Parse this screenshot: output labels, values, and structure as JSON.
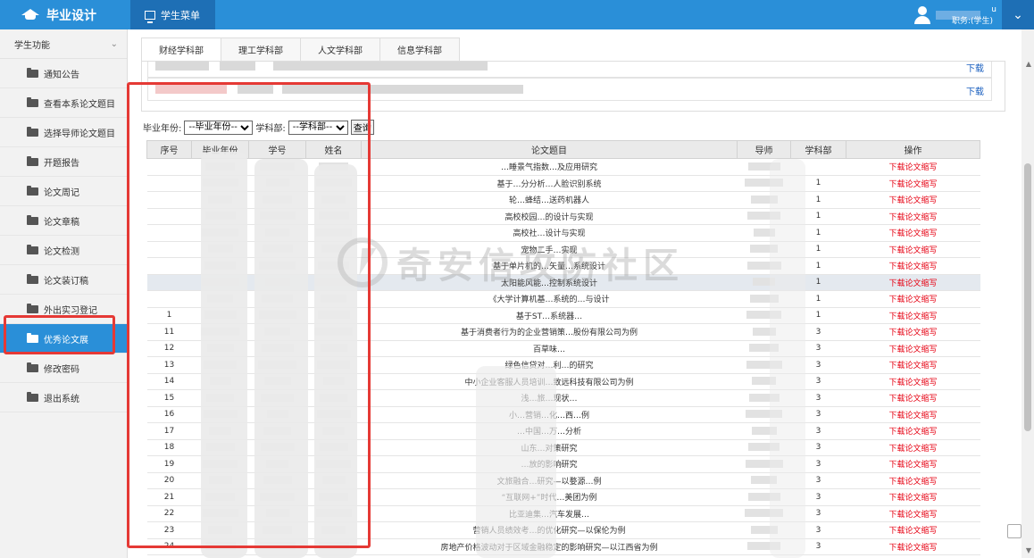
{
  "app": {
    "title": "毕业设计",
    "menu_label": "学生菜单"
  },
  "user": {
    "role": "职务:(学生)",
    "suffix": "u"
  },
  "sidebar": {
    "section_title": "学生功能",
    "items": [
      {
        "label": "通知公告"
      },
      {
        "label": "查看本系论文题目"
      },
      {
        "label": "选择导师论文题目"
      },
      {
        "label": "开题报告"
      },
      {
        "label": "论文周记"
      },
      {
        "label": "论文章稿"
      },
      {
        "label": "论文检测"
      },
      {
        "label": "论文装订稿"
      },
      {
        "label": "外出实习登记"
      },
      {
        "label": "优秀论文展"
      },
      {
        "label": "修改密码"
      },
      {
        "label": "退出系统"
      }
    ],
    "active_index": 9
  },
  "tabs": [
    "财经学科部",
    "理工学科部",
    "人文学科部",
    "信息学科部"
  ],
  "upper_rows": [
    {
      "download": "下载"
    },
    {
      "download": "下载"
    }
  ],
  "filter": {
    "year_label": "毕业年份:",
    "year_value": "--毕业年份--",
    "dept_label": "学科部:",
    "dept_value": "--学科部--",
    "query_label": "查询"
  },
  "table": {
    "headers": [
      "序号",
      "毕业年份",
      "学号",
      "姓名",
      "论文题目",
      "导师",
      "学科部",
      "操作"
    ],
    "rows": [
      {
        "seq": "",
        "title": "…睡景气指数…及应用研究",
        "dept": "",
        "op": "下载论文缩写"
      },
      {
        "seq": "",
        "title": "基于…分分析…人脸识别系统",
        "dept": "1",
        "op": "下载论文缩写"
      },
      {
        "seq": "",
        "title": "轮…蜂结…送药机器人",
        "dept": "1",
        "op": "下载论文缩写"
      },
      {
        "seq": "",
        "title": "高校校园…的设计与实现",
        "dept": "1",
        "op": "下载论文缩写"
      },
      {
        "seq": "",
        "title": "高校社…设计与实现",
        "dept": "1",
        "op": "下载论文缩写"
      },
      {
        "seq": "",
        "title": "宠物二手…实现",
        "dept": "1",
        "op": "下载论文缩写"
      },
      {
        "seq": "",
        "title": "基于单片机的…矢量…系统设计",
        "dept": "1",
        "op": "下载论文缩写"
      },
      {
        "seq": "",
        "title": "太阳能风能…控制系统设计",
        "dept": "1",
        "op": "下载论文缩写"
      },
      {
        "seq": "",
        "title": "《大学计算机基…系统的…与设计",
        "dept": "1",
        "op": "下载论文缩写"
      },
      {
        "seq": "1",
        "title": "基于ST…系统器…",
        "dept": "1",
        "op": "下载论文缩写"
      },
      {
        "seq": "11",
        "title": "基于消费者行为的企业营销策…股份有限公司为例",
        "dept": "3",
        "op": "下载论文缩写"
      },
      {
        "seq": "12",
        "title": "百草味…",
        "dept": "3",
        "op": "下载论文缩写"
      },
      {
        "seq": "13",
        "title": "绿色信贷对…利…的研究",
        "dept": "3",
        "op": "下载论文缩写"
      },
      {
        "seq": "14",
        "title": "中小企业客服人员培训…致远科技有限公司为例",
        "dept": "3",
        "op": "下载论文缩写"
      },
      {
        "seq": "15",
        "title": "浅…旅…现状…",
        "dept": "3",
        "op": "下载论文缩写"
      },
      {
        "seq": "16",
        "title": "小…营销…化…西…例",
        "dept": "3",
        "op": "下载论文缩写"
      },
      {
        "seq": "17",
        "title": "…中国…万…分析",
        "dept": "3",
        "op": "下载论文缩写"
      },
      {
        "seq": "18",
        "title": "山东…对策研究",
        "dept": "3",
        "op": "下载论文缩写"
      },
      {
        "seq": "19",
        "title": "…放的影响研究",
        "dept": "3",
        "op": "下载论文缩写"
      },
      {
        "seq": "20",
        "title": "文旅融合…研究—以婺源…例",
        "dept": "3",
        "op": "下载论文缩写"
      },
      {
        "seq": "21",
        "title": "“互联网+”时代…美团为例",
        "dept": "3",
        "op": "下载论文缩写"
      },
      {
        "seq": "22",
        "title": "比亚迪集…汽车发展…",
        "dept": "3",
        "op": "下载论文缩写"
      },
      {
        "seq": "23",
        "title": "营销人员绩效考…的优化研究—以保伦为例",
        "dept": "3",
        "op": "下载论文缩写"
      },
      {
        "seq": "24",
        "title": "房地产价格波动对于区域金融稳定的影响研究—以江西省为例",
        "dept": "3",
        "op": "下载论文缩写"
      }
    ]
  },
  "watermark": "奇安信攻防社区",
  "colors": {
    "brand": "#2a8fd8",
    "brand_dark": "#1e6fb5",
    "alert": "#e60012",
    "annotation": "#e53935"
  }
}
